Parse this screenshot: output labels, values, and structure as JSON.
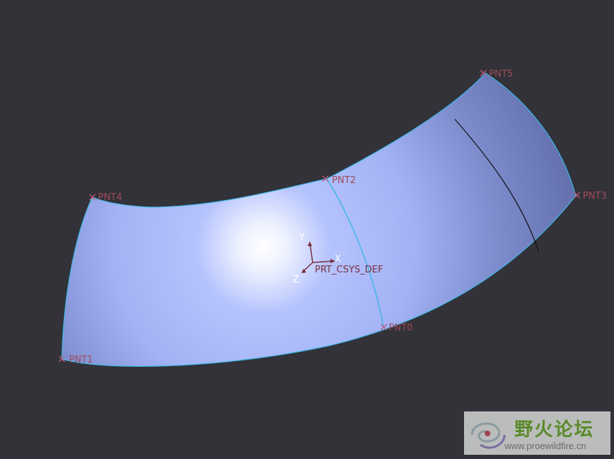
{
  "viewport": {
    "background": "#323238",
    "surface_color": "#a9b8fb",
    "edge_color": "#3fb7e8",
    "datum_point_color": "#c05a80"
  },
  "datum_points": [
    {
      "name": "PNT0"
    },
    {
      "name": "PNT1"
    },
    {
      "name": "PNT2"
    },
    {
      "name": "PNT3"
    },
    {
      "name": "PNT4"
    },
    {
      "name": "PNT5"
    }
  ],
  "csys": {
    "name": "PRT_CSYS_DEF",
    "axes": {
      "x": "X",
      "y": "Y",
      "z": "Z"
    }
  },
  "watermark": {
    "title": "野火论坛",
    "url": "www.proewildfire.cn",
    "logo_icon": "swirl-logo-icon"
  }
}
